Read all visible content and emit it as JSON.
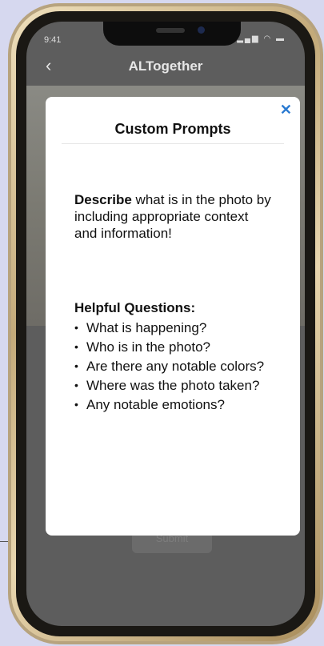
{
  "status_bar": {
    "time": "9:41",
    "icons": "signal wifi battery"
  },
  "header": {
    "title": "ALTogether",
    "back_icon": "chevron-left-icon"
  },
  "background": {
    "submit_label": "Submit"
  },
  "modal": {
    "title": "Custom Prompts",
    "close_icon": "close-icon",
    "prompt_bold": "Describe",
    "prompt_rest": " what is in the photo by including appropriate context and information!",
    "helpful_heading": "Helpful Questions:",
    "questions": [
      "What is happening?",
      "Who is in the photo?",
      "Are there any notable colors?",
      "Where was the photo taken?",
      "Any notable emotions?"
    ]
  },
  "colors": {
    "accent": "#2a7ad1",
    "frame_gold": "#c3aa7a",
    "page_bg": "#d6d8ef"
  }
}
